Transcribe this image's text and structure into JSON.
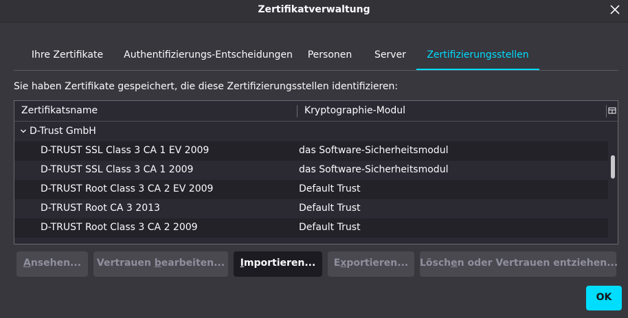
{
  "window": {
    "title": "Zertifikatverwaltung"
  },
  "tabs": [
    {
      "label": "Ihre Zertifikate"
    },
    {
      "label": "Authentifizierungs-Entscheidungen"
    },
    {
      "label": "Personen"
    },
    {
      "label": "Server"
    },
    {
      "label": "Zertifizierungsstellen"
    }
  ],
  "description": "Sie haben Zertifikate gespeichert, die diese Zertifizierungsstellen identifizieren:",
  "tree": {
    "columns": [
      "Zertifikatsname",
      "Kryptographie-Modul"
    ],
    "group": "D-Trust GmbH",
    "rows": [
      {
        "name": "D-TRUST SSL Class 3 CA 1 EV 2009",
        "module": "das Software-Sicherheitsmodul"
      },
      {
        "name": "D-TRUST SSL Class 3 CA 1 2009",
        "module": "das Software-Sicherheitsmodul"
      },
      {
        "name": "D-TRUST Root Class 3 CA 2 EV 2009",
        "module": "Default Trust"
      },
      {
        "name": "D-TRUST Root CA 3 2013",
        "module": "Default Trust"
      },
      {
        "name": "D-TRUST Root Class 3 CA 2 2009",
        "module": "Default Trust"
      }
    ]
  },
  "buttons": {
    "view": {
      "pre": "",
      "key": "A",
      "post": "nsehen..."
    },
    "edit": {
      "pre": "Vertrauen ",
      "key": "b",
      "post": "earbeiten..."
    },
    "import": {
      "pre": "",
      "key": "I",
      "post": "mportieren..."
    },
    "export": {
      "pre": "E",
      "key": "x",
      "post": "portieren..."
    },
    "delete": {
      "pre": "Lösch",
      "key": "e",
      "post": "n oder Vertrauen entziehen..."
    },
    "ok": "OK"
  },
  "colors": {
    "accent": "#00ddff",
    "background": "#38373d",
    "tree_bg": "#2b2a33"
  },
  "icons": {
    "close": "close-icon",
    "twisty": "chevron-down-icon",
    "column_picker": "column-picker-icon"
  }
}
